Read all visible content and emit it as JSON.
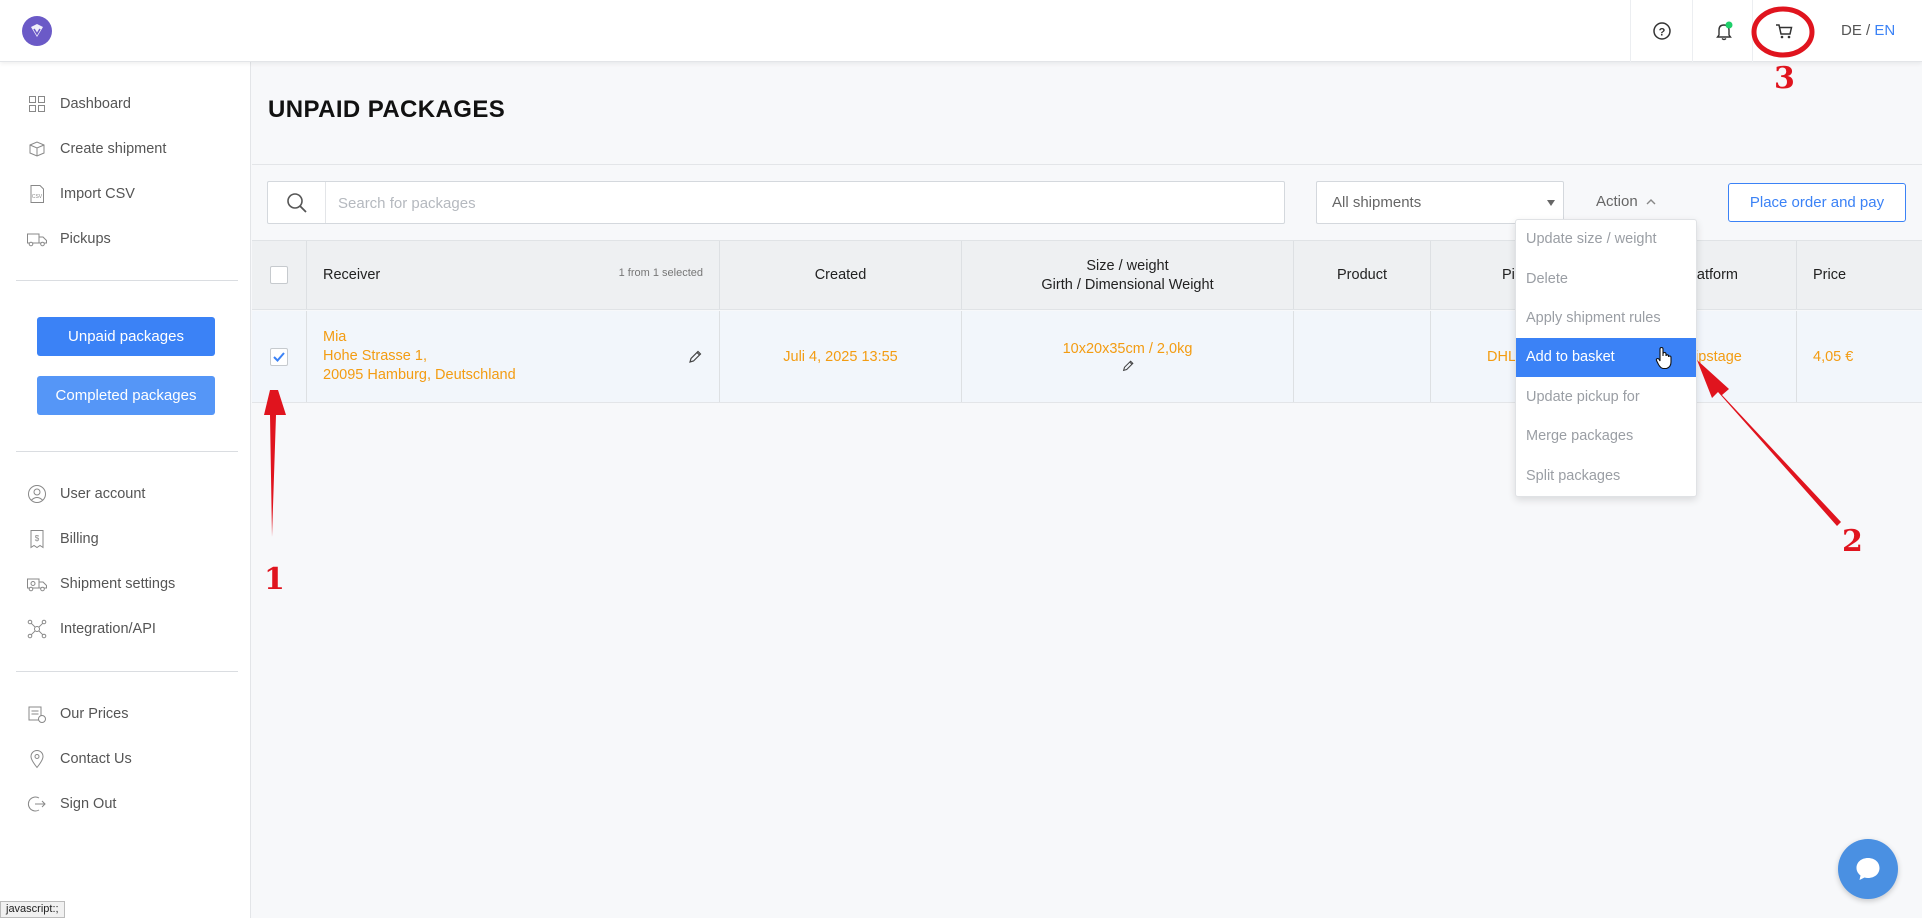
{
  "header": {
    "lang_de": "DE",
    "lang_sep": " / ",
    "lang_en": "EN",
    "icons": [
      "help-icon",
      "bell-icon",
      "cart-icon"
    ],
    "notification_dot_color": "#1ecf6a"
  },
  "sidebar": {
    "items_top": [
      {
        "label": "Dashboard",
        "icon": "dashboard-icon"
      },
      {
        "label": "Create shipment",
        "icon": "package-icon"
      },
      {
        "label": "Import CSV",
        "icon": "csv-icon"
      },
      {
        "label": "Pickups",
        "icon": "truck-icon"
      }
    ],
    "buttons": {
      "unpaid": "Unpaid packages",
      "completed": "Completed packages"
    },
    "items_account": [
      {
        "label": "User account",
        "icon": "user-icon"
      },
      {
        "label": "Billing",
        "icon": "billing-icon"
      },
      {
        "label": "Shipment settings",
        "icon": "shipment-settings-icon"
      },
      {
        "label": "Integration/API",
        "icon": "api-icon"
      }
    ],
    "items_bottom": [
      {
        "label": "Our Prices",
        "icon": "prices-icon"
      },
      {
        "label": "Contact Us",
        "icon": "location-icon"
      },
      {
        "label": "Sign Out",
        "icon": "sign-out-icon"
      }
    ]
  },
  "main": {
    "title": "UNPAID PACKAGES",
    "search_placeholder": "Search for packages",
    "filter_value": "All shipments",
    "action_label": "Action",
    "place_order_label": "Place order and pay"
  },
  "table": {
    "headers": {
      "receiver": "Receiver",
      "selected_count": "1 from 1 selected",
      "created": "Created",
      "size_line1": "Size / weight",
      "size_line2": "Girth / Dimensional Weight",
      "product": "Product",
      "pickup_partial": "Pi",
      "platform_partial": "Platform",
      "price": "Price"
    },
    "row": {
      "checked": true,
      "receiver_name": "Mia",
      "receiver_street": "Hohe Strasse 1,",
      "receiver_city": "20095 Hamburg, Deutschland",
      "created": "Juli 4, 2025 13:55",
      "size": "10x20x35cm / 2,0kg",
      "product": "",
      "pickup_partial": "DHL",
      "platform_partial": "hipstage",
      "price": "4,05 €"
    }
  },
  "action_menu": {
    "items": [
      "Update size / weight",
      "Delete",
      "Apply shipment rules",
      "Add to basket",
      "Update pickup for",
      "Merge packages",
      "Split packages"
    ],
    "active_index": 3
  },
  "status_bar": "javascript:;",
  "annotations": [
    "1",
    "2",
    "3"
  ],
  "colors": {
    "primary": "#3b82f6",
    "accent_orange": "#f39c12",
    "annotation_red": "#e0141e"
  }
}
